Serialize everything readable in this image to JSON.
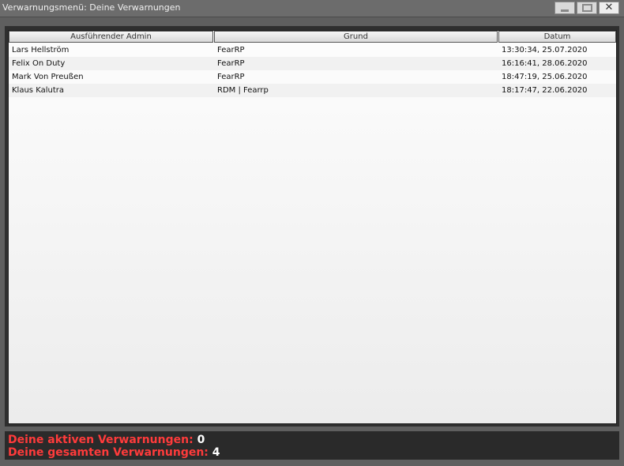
{
  "window": {
    "title": "Verwarnungsmenü: Deine Verwarnungen",
    "controls": {
      "minimize": "minimize-icon",
      "maximize": "maximize-icon",
      "close": "close-icon"
    }
  },
  "table": {
    "columns": [
      "Ausführender Admin",
      "Grund",
      "Datum"
    ],
    "rows": [
      {
        "admin": "Lars Hellström",
        "grund": "FearRP",
        "datum": "13:30:34, 25.07.2020"
      },
      {
        "admin": "Felix On Duty",
        "grund": "FearRP",
        "datum": "16:16:41, 28.06.2020"
      },
      {
        "admin": "Mark Von Preußen",
        "grund": "FearRP",
        "datum": "18:47:19, 25.06.2020"
      },
      {
        "admin": "Klaus Kalutra",
        "grund": "RDM | Fearrp",
        "datum": "18:17:47, 22.06.2020"
      }
    ]
  },
  "footer": {
    "active_label": "Deine aktiven Verwarnungen:",
    "active_count": "0",
    "total_label": "Deine gesamten Verwarnungen:",
    "total_count": "4"
  },
  "colors": {
    "footer_label": "#ff3b3b",
    "footer_value": "#ffffff",
    "title_bar": "#6c6c6c"
  }
}
